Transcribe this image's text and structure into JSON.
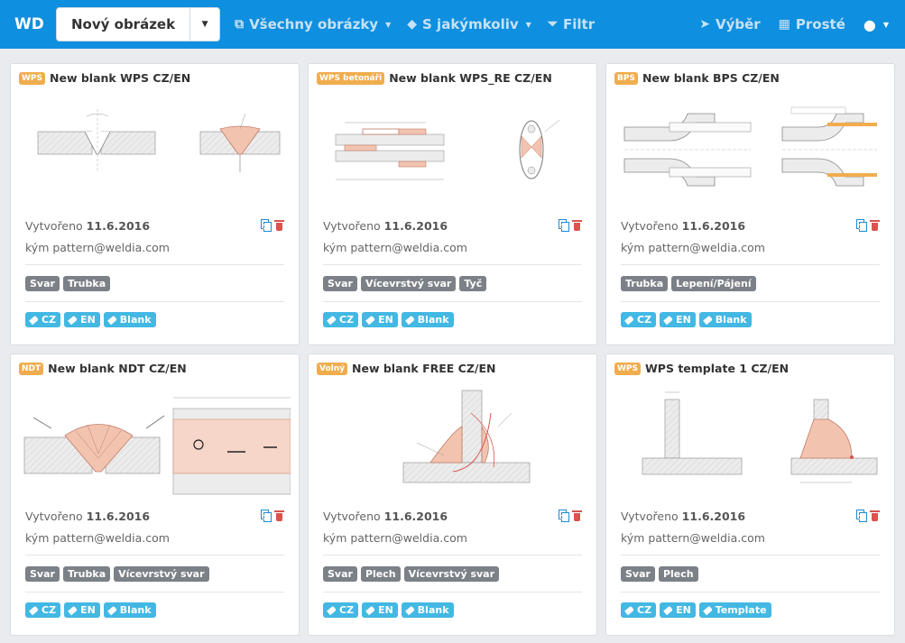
{
  "app": {
    "brand": "WD"
  },
  "toolbar": {
    "new_label": "Nový obrázek",
    "all_images": "Všechny obrázky",
    "any_tag": "S jakýmkoliv",
    "filter": "Filtr",
    "select": "Výběr",
    "simple": "Prosté"
  },
  "cards": [
    {
      "badge": "WPS",
      "title": "New blank WPS CZ/EN",
      "created_label": "Vytvořeno",
      "created_date": "11.6.2016",
      "by": "kým pattern@weldia.com",
      "tags": [
        "Svar",
        "Trubka"
      ],
      "languages": [
        "CZ",
        "EN",
        "Blank"
      ]
    },
    {
      "badge": "WPS betonáři",
      "title": "New blank WPS_RE CZ/EN",
      "created_label": "Vytvořeno",
      "created_date": "11.6.2016",
      "by": "kým pattern@weldia.com",
      "tags": [
        "Svar",
        "Vícevrstvý svar",
        "Tyč"
      ],
      "languages": [
        "CZ",
        "EN",
        "Blank"
      ]
    },
    {
      "badge": "BPS",
      "title": "New blank BPS CZ/EN",
      "created_label": "Vytvořeno",
      "created_date": "11.6.2016",
      "by": "kým pattern@weldia.com",
      "tags": [
        "Trubka",
        "Lepení/Pájení"
      ],
      "languages": [
        "CZ",
        "EN",
        "Blank"
      ]
    },
    {
      "badge": "NDT",
      "title": "New blank NDT CZ/EN",
      "created_label": "Vytvořeno",
      "created_date": "11.6.2016",
      "by": "kým pattern@weldia.com",
      "tags": [
        "Svar",
        "Trubka",
        "Vícevrstvý svar"
      ],
      "languages": [
        "CZ",
        "EN",
        "Blank"
      ]
    },
    {
      "badge": "Volný",
      "title": "New blank FREE CZ/EN",
      "created_label": "Vytvořeno",
      "created_date": "11.6.2016",
      "by": "kým pattern@weldia.com",
      "tags": [
        "Svar",
        "Plech",
        "Vícevrstvý svar"
      ],
      "languages": [
        "CZ",
        "EN",
        "Blank"
      ]
    },
    {
      "badge": "WPS",
      "title": "WPS template 1 CZ/EN",
      "created_label": "Vytvořeno",
      "created_date": "11.6.2016",
      "by": "kým pattern@weldia.com",
      "tags": [
        "Svar",
        "Plech"
      ],
      "languages": [
        "CZ",
        "EN",
        "Template"
      ]
    }
  ],
  "colors": {
    "topbar": "#0f8fdf",
    "badge": "#f0ad4e",
    "tag": "#7c8087",
    "lang_tag": "#43b8e3",
    "weld_fill": "#f2c4b0"
  }
}
